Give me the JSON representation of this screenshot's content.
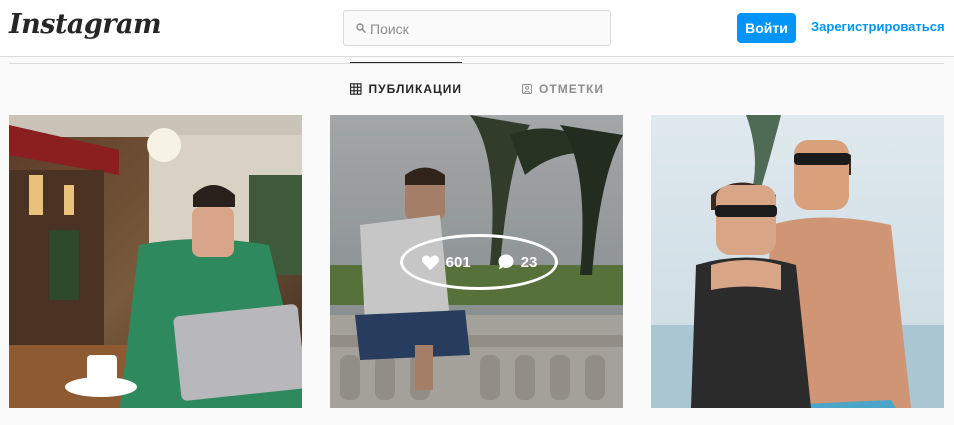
{
  "header": {
    "logo": "Instagram",
    "search_placeholder": "Поиск",
    "login_label": "Войти",
    "signup_label": "Зарегистрироваться"
  },
  "tabs": [
    {
      "label": "ПУБЛИКАЦИИ",
      "icon": "grid-icon",
      "active": true
    },
    {
      "label": "ОТМЕТКИ",
      "icon": "tagged-user-icon",
      "active": false
    }
  ],
  "posts": [
    {
      "description": "man in green sweater with laptop at cafe"
    },
    {
      "description": "man sitting on balustrade under palm trees",
      "likes": "601",
      "comments": "23",
      "hovered": true
    },
    {
      "description": "couple on beach with sunglasses"
    }
  ],
  "colors": {
    "accent": "#0095f6",
    "text": "#262626",
    "muted": "#8e8e8e",
    "border": "#dbdbdb",
    "background": "#fafafa"
  }
}
